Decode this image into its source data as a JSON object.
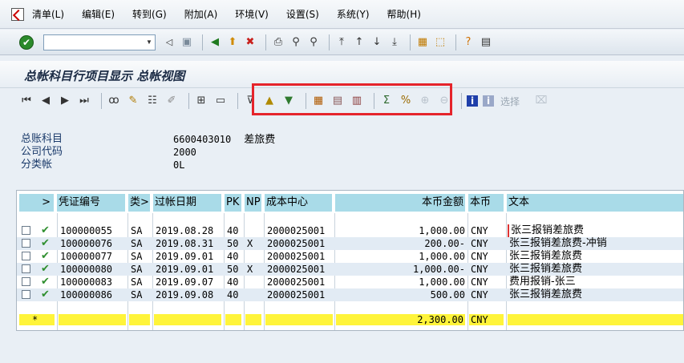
{
  "menu": {
    "items": [
      "清单(L)",
      "编辑(E)",
      "转到(G)",
      "附加(A)",
      "环境(V)",
      "设置(S)",
      "系统(Y)",
      "帮助(H)"
    ]
  },
  "toolbar": {
    "command_value": "",
    "icons": [
      "ok-icon",
      "back-icon",
      "save-icon",
      "green-back-icon",
      "exit-icon",
      "cancel-icon",
      "print-icon",
      "find-icon",
      "find-next-icon",
      "first-page-icon",
      "prev-page-icon",
      "next-page-icon",
      "last-page-icon",
      "new-session-icon",
      "shortcut-icon",
      "help-icon",
      "layout-icon"
    ]
  },
  "title": "总帐科目行项目显示 总帐视图",
  "app_toolbar": {
    "select_label": "选择"
  },
  "info": {
    "gl_account_label": "总账科目",
    "gl_account_value": "6600403010",
    "gl_account_text": "差旅费",
    "company_code_label": "公司代码",
    "company_code_value": "2000",
    "ledger_label": "分类帐",
    "ledger_value": "0L"
  },
  "table": {
    "columns": [
      ">",
      "凭证编号",
      "类>",
      "过帐日期",
      "PK",
      "NP",
      "成本中心",
      "本币金额",
      "本币",
      "文本"
    ],
    "rows": [
      {
        "doc": "100000055",
        "type": "SA",
        "date": "2019.08.28",
        "pk": "40",
        "np": "",
        "cc": "2000025001",
        "amount": "1,000.00",
        "cur": "CNY",
        "text": "张三报销差旅费"
      },
      {
        "doc": "100000076",
        "type": "SA",
        "date": "2019.08.31",
        "pk": "50",
        "np": "X",
        "cc": "2000025001",
        "amount": "200.00-",
        "cur": "CNY",
        "text": "张三报销差旅费-冲销"
      },
      {
        "doc": "100000077",
        "type": "SA",
        "date": "2019.09.01",
        "pk": "40",
        "np": "",
        "cc": "2000025001",
        "amount": "1,000.00",
        "cur": "CNY",
        "text": "张三报销差旅费"
      },
      {
        "doc": "100000080",
        "type": "SA",
        "date": "2019.09.01",
        "pk": "50",
        "np": "X",
        "cc": "2000025001",
        "amount": "1,000.00-",
        "cur": "CNY",
        "text": "张三报销差旅费"
      },
      {
        "doc": "100000083",
        "type": "SA",
        "date": "2019.09.07",
        "pk": "40",
        "np": "",
        "cc": "2000025001",
        "amount": "1,000.00",
        "cur": "CNY",
        "text": "费用报销-张三"
      },
      {
        "doc": "100000086",
        "type": "SA",
        "date": "2019.09.08",
        "pk": "40",
        "np": "",
        "cc": "2000025001",
        "amount": "500.00",
        "cur": "CNY",
        "text": "张三报销差旅费"
      }
    ],
    "total": {
      "marker": "*",
      "amount": "2,300.00",
      "cur": "CNY"
    }
  }
}
